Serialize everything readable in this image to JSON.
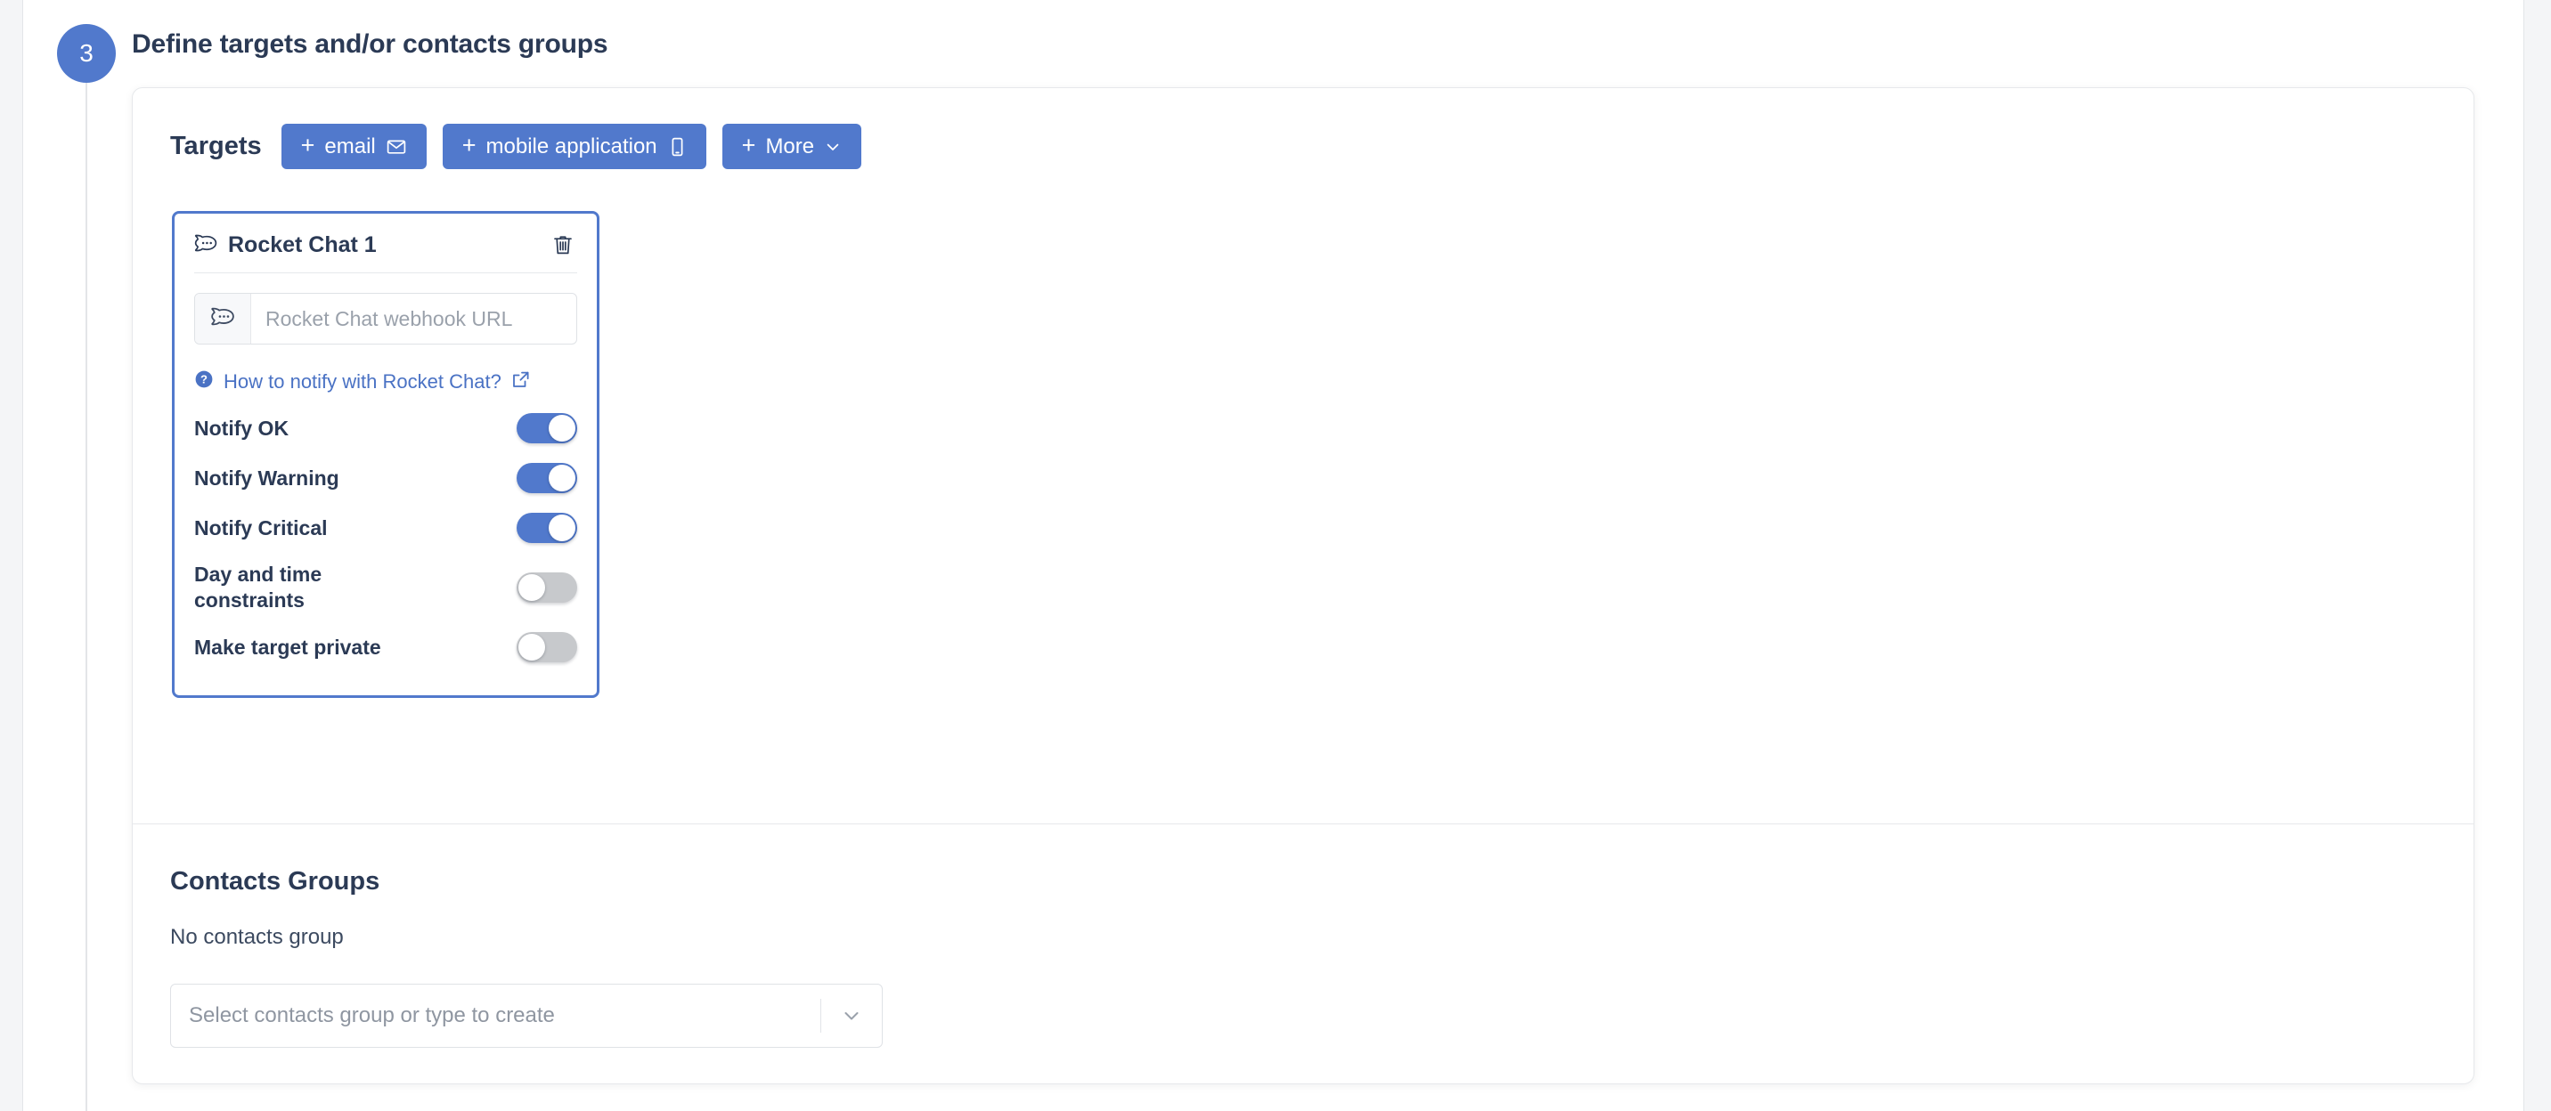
{
  "page": {
    "accent_color": "#5179cc",
    "text_color": "#2b3a55",
    "off_toggle_color": "#c7c9cc"
  },
  "step": {
    "number": "3",
    "title": "Define targets and/or contacts groups"
  },
  "targets": {
    "label": "Targets",
    "buttons": [
      {
        "label": "email",
        "icon": "envelope-icon",
        "plus": "+"
      },
      {
        "label": "mobile application",
        "icon": "mobile-icon",
        "plus": "+"
      },
      {
        "label": "More",
        "icon": "chevron-down-icon",
        "plus": "+"
      }
    ],
    "card": {
      "title": "Rocket Chat 1",
      "icon": "rocket-chat-icon",
      "delete_icon": "trash-icon",
      "webhook": {
        "placeholder": "Rocket Chat webhook URL",
        "value": "",
        "addon_icon": "rocket-chat-icon"
      },
      "help_link": {
        "text": "How to notify with Rocket Chat?",
        "help_icon": "question-circle-icon",
        "external_icon": "external-link-icon"
      },
      "toggles": [
        {
          "label": "Notify OK",
          "state": "on"
        },
        {
          "label": "Notify Warning",
          "state": "on"
        },
        {
          "label": "Notify Critical",
          "state": "on"
        },
        {
          "label": "Day and time constraints",
          "state": "off"
        },
        {
          "label": "Make target private",
          "state": "off"
        }
      ]
    }
  },
  "contacts": {
    "title": "Contacts Groups",
    "empty_text": "No contacts group",
    "select": {
      "placeholder": "Select contacts group or type to create",
      "value": "Select contacts group or type to create",
      "caret_icon": "chevron-down-icon"
    }
  }
}
